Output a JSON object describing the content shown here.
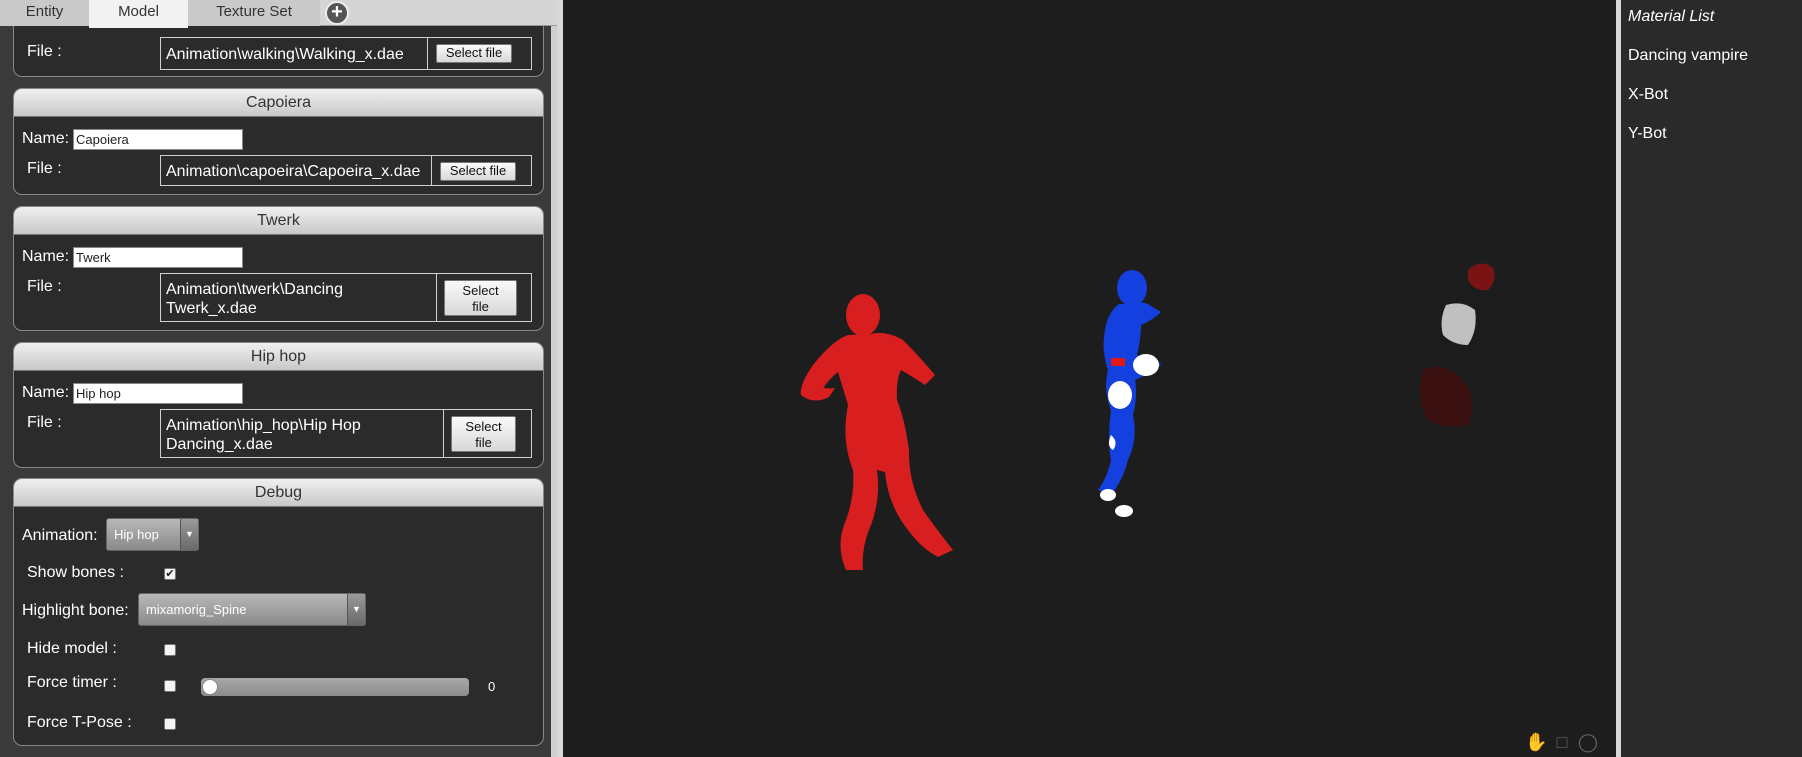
{
  "tabs": [
    {
      "label": "Entity"
    },
    {
      "label": "Model"
    },
    {
      "label": "Texture Set"
    }
  ],
  "tab_add_symbol": "+",
  "sections": {
    "walking": {
      "file_label": "File :",
      "file_path": "Animation\\walking\\Walking_x.dae",
      "button": "Select file"
    },
    "capoiera": {
      "title": "Capoiera",
      "name_label": "Name:",
      "name_value": "Capoiera",
      "file_label": "File :",
      "file_path": "Animation\\capoeira\\Capoeira_x.dae",
      "button": "Select file"
    },
    "twerk": {
      "title": "Twerk",
      "name_label": "Name:",
      "name_value": "Twerk",
      "file_label": "File :",
      "file_path_line1": "Animation\\twerk\\Dancing",
      "file_path_line2": "Twerk_x.dae",
      "button_line1": "Select",
      "button_line2": "file"
    },
    "hiphop": {
      "title": "Hip hop",
      "name_label": "Name:",
      "name_value": "Hip hop",
      "file_label": "File :",
      "file_path_line1": "Animation\\hip_hop\\Hip Hop",
      "file_path_line2": "Dancing_x.dae",
      "button_line1": "Select",
      "button_line2": "file"
    }
  },
  "debug": {
    "title": "Debug",
    "animation_label": "Animation:",
    "animation_value": "Hip hop",
    "show_bones_label": "Show bones :",
    "show_bones_checked": true,
    "highlight_bone_label": "Highlight bone:",
    "highlight_bone_value": "mixamorig_Spine",
    "hide_model_label": "Hide model :",
    "hide_model_checked": false,
    "force_timer_label": "Force timer :",
    "force_timer_checked": false,
    "force_timer_value": "0",
    "force_tpose_label": "Force T-Pose :",
    "force_tpose_checked": false
  },
  "viewport": {
    "background": "#1d1d1d",
    "figures": [
      {
        "name": "red-figure",
        "color": "#d81e1e"
      },
      {
        "name": "blue-figure",
        "color": "#1440e0"
      },
      {
        "name": "dark-figure",
        "color": "#2a2a2a"
      }
    ],
    "toolbar_icons": [
      "hand-icon",
      "bounding-box-icon",
      "globe-icon"
    ]
  },
  "material_list": {
    "title": "Material List",
    "items": [
      "Dancing vampire",
      "X-Bot",
      "Y-Bot"
    ]
  },
  "colors": {
    "panel_bg": "#3a3a3a",
    "section_bg": "#2b2b2b",
    "viewport_bg": "#1d1d1d",
    "divider": "#d8d8d8"
  }
}
